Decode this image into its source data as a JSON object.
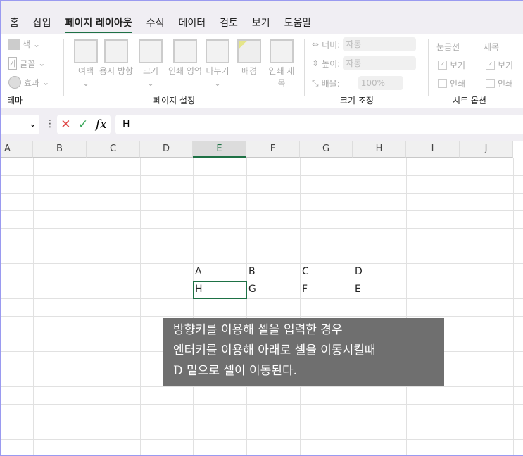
{
  "tabs": [
    "홈",
    "삽입",
    "페이지 레이아웃",
    "수식",
    "데이터",
    "검토",
    "보기",
    "도움말"
  ],
  "active_tab": "페이지 레이아웃",
  "theme": {
    "colors": "색",
    "fonts": "글꼴",
    "effects": "효과",
    "label": "테마"
  },
  "page_setup": {
    "margins": "여백",
    "orientation": "용지 방향",
    "size": "크기",
    "print_area": "인쇄 영역",
    "breaks": "나누기",
    "background": "배경",
    "print_titles": "인쇄 제목",
    "label": "페이지 설정"
  },
  "scale": {
    "width_label": "너비:",
    "width_value": "자동",
    "height_label": "높이:",
    "height_value": "자동",
    "scale_label": "배율:",
    "scale_value": "100%",
    "label": "크기 조정"
  },
  "sheet_options": {
    "gridlines": "눈금선",
    "headings": "제목",
    "view": "보기",
    "print": "인쇄",
    "label": "시트 옵션"
  },
  "formula_bar": {
    "value": "H",
    "fx": "fx"
  },
  "columns": [
    "A",
    "B",
    "C",
    "D",
    "E",
    "F",
    "G",
    "H",
    "I",
    "J"
  ],
  "active_column": "E",
  "cells": [
    {
      "ref": "E16",
      "value": "A"
    },
    {
      "ref": "F16",
      "value": "B"
    },
    {
      "ref": "G16",
      "value": "C"
    },
    {
      "ref": "H16",
      "value": "D"
    },
    {
      "ref": "E17",
      "value": "H"
    },
    {
      "ref": "F17",
      "value": "G"
    },
    {
      "ref": "G17",
      "value": "F"
    },
    {
      "ref": "H17",
      "value": "E"
    }
  ],
  "note": [
    "방향키를 이용해 셀을 입력한 경우",
    "엔터키를 이용해 아래로 셀을 이동시킬때",
    "D 밑으로 셀이 이동된다."
  ]
}
